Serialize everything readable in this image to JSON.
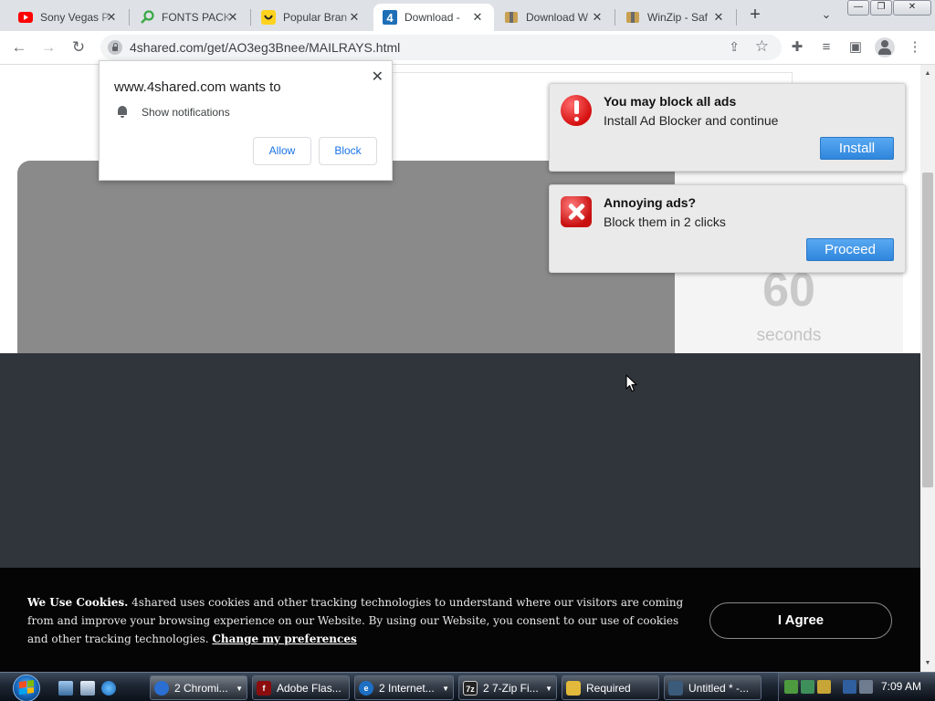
{
  "browser": {
    "tabs": [
      {
        "title": "Sony Vegas P",
        "favicon": "youtube-icon",
        "active": false
      },
      {
        "title": "FONTS PACK",
        "favicon": "magnifier-icon",
        "active": false
      },
      {
        "title": "Popular Bran",
        "favicon": "smiley-icon",
        "active": false
      },
      {
        "title": "Download -",
        "favicon": "4shared-icon",
        "active": true
      },
      {
        "title": "Download W",
        "favicon": "winzip-icon",
        "active": false
      },
      {
        "title": "WinZip - Saf",
        "favicon": "winzip-icon",
        "active": false
      }
    ],
    "url": "4shared.com/get/AO3eg3Bnee/MAILRAYS.html",
    "window_buttons": {
      "minimize": "—",
      "maximize": "❐",
      "close": "✕"
    }
  },
  "permission_popup": {
    "title": "www.4shared.com wants to",
    "request": "Show notifications",
    "allow_label": "Allow",
    "block_label": "Block"
  },
  "ad_notifications": [
    {
      "heading": "You may block all ads",
      "subtext": "Install Ad Blocker and continue",
      "button": "Install",
      "icon": "exclamation-icon"
    },
    {
      "heading": "Annoying ads?",
      "subtext": "Block them in 2 clicks",
      "button": "Proceed",
      "icon": "error-x-icon"
    }
  ],
  "countdown": {
    "number": "60",
    "label": "seconds"
  },
  "cookie_banner": {
    "bold_lead": "We Use Cookies.",
    "text": " 4shared uses cookies and other tracking technologies to understand where our visitors are coming from and improve your browsing experience on our Website. By using our Website, you consent to our use of cookies and other tracking technologies. ",
    "link": "Change my preferences",
    "agree_label": "I Agree"
  },
  "taskbar": {
    "tasks": [
      {
        "label": "2 Chromi...",
        "icon": "chrome-icon",
        "color": "#2a6fd1",
        "dropdown": true,
        "active": true
      },
      {
        "label": "Adobe Flas...",
        "icon": "flash-icon",
        "color": "#8b0d0d",
        "dropdown": false,
        "active": false
      },
      {
        "label": "2 Internet...",
        "icon": "ie-icon",
        "color": "#1d6fc4",
        "dropdown": true,
        "active": false
      },
      {
        "label": "2 7-Zip Fi...",
        "icon": "7zip-icon",
        "color": "#222222",
        "dropdown": true,
        "active": false
      },
      {
        "label": "Required",
        "icon": "folder-icon",
        "color": "#e2b93b",
        "dropdown": false,
        "active": false
      },
      {
        "label": "Untitled * -...",
        "icon": "video-editor-icon",
        "color": "#3b5b7a",
        "dropdown": false,
        "active": false
      }
    ],
    "clock": "7:09 AM"
  },
  "colors": {
    "accent_blue": "#2f86dc",
    "cookie_bg": "#050505",
    "dark_section": "#30353b",
    "video_gray": "#8a8a8a"
  }
}
